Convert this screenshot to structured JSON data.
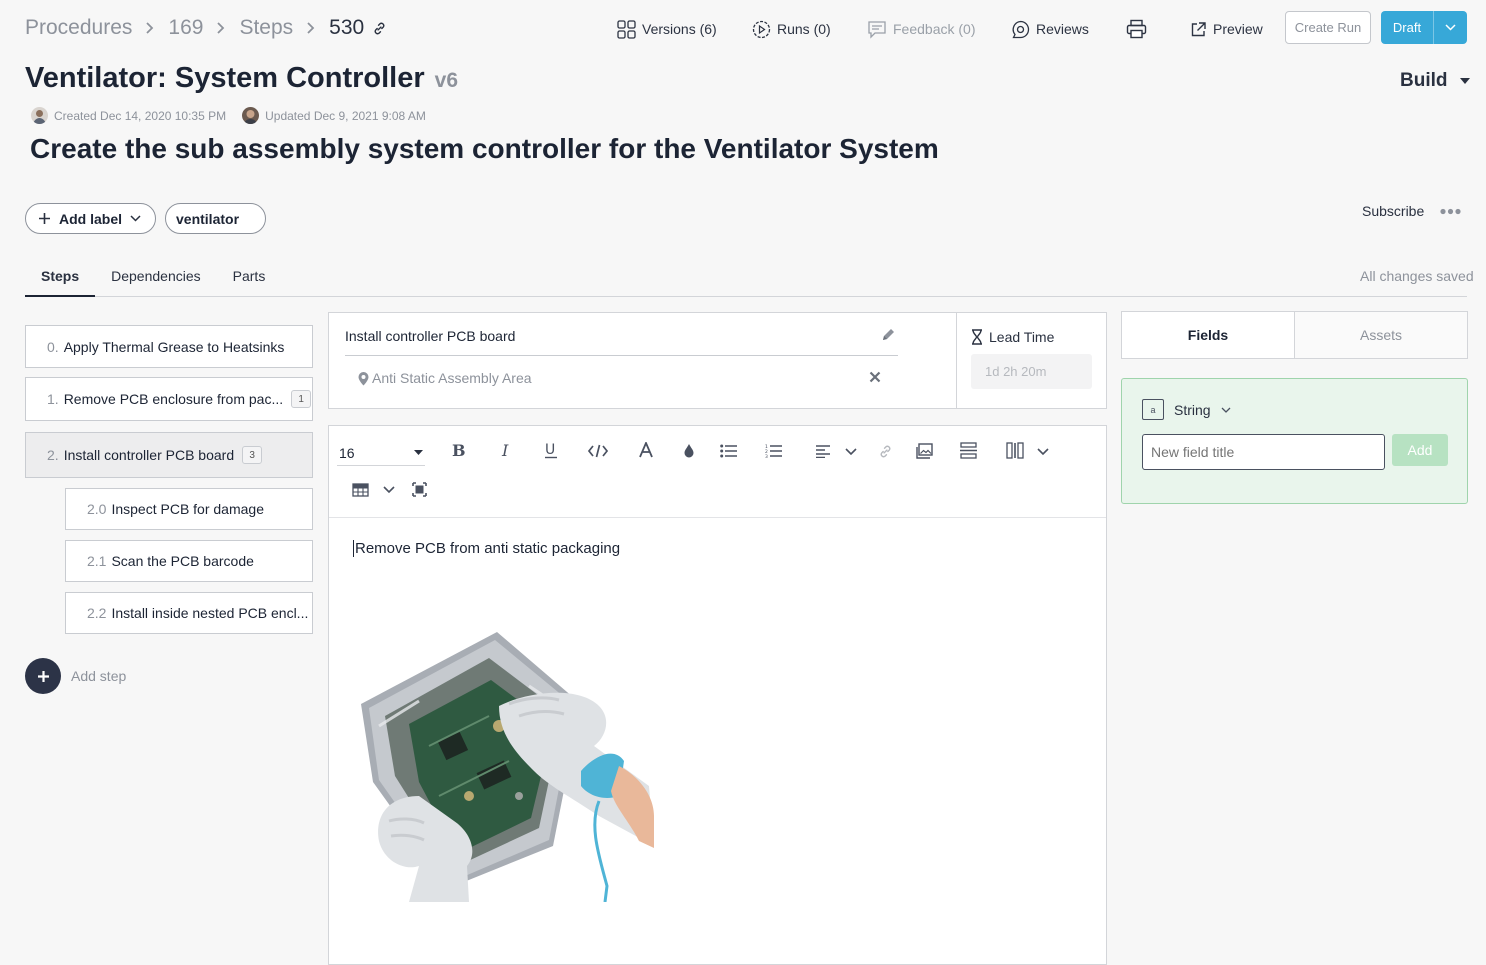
{
  "breadcrumb": {
    "root": "Procedures",
    "procedure_id": "169",
    "section": "Steps",
    "step_id": "530"
  },
  "topnav": {
    "versions": "Versions (6)",
    "runs": "Runs (0)",
    "feedback": "Feedback (0)",
    "reviews": "Reviews",
    "preview": "Preview",
    "create_run": "Create Run",
    "draft": "Draft"
  },
  "header": {
    "title": "Ventilator: System Controller",
    "version": "v6",
    "mode": "Build",
    "created": "Created Dec 14, 2020 10:35 PM",
    "updated": "Updated Dec 9, 2021 9:08 AM",
    "description": "Create the sub assembly system controller for the Ventilator System"
  },
  "labels": {
    "add_label": "Add label",
    "chips": [
      "ventilator"
    ]
  },
  "subscribe": "Subscribe",
  "tabs": [
    {
      "label": "Steps",
      "active": true
    },
    {
      "label": "Dependencies",
      "active": false
    },
    {
      "label": "Parts",
      "active": false
    }
  ],
  "save_status": "All changes saved",
  "steps": [
    {
      "num": "0.",
      "label": "Apply Thermal Grease to Heatsinks",
      "badge": null
    },
    {
      "num": "1.",
      "label": "Remove PCB enclosure from pac...",
      "badge": "1"
    },
    {
      "num": "2.",
      "label": "Install controller PCB board",
      "badge": "3"
    }
  ],
  "substeps": [
    {
      "num": "2.0",
      "label": "Inspect PCB for damage"
    },
    {
      "num": "2.1",
      "label": "Scan the PCB barcode"
    },
    {
      "num": "2.2",
      "label": "Install inside nested PCB encl..."
    }
  ],
  "add_step": "Add step",
  "step_detail": {
    "name": "Install controller PCB board",
    "location": "Anti Static Assembly Area",
    "lead_time_label": "Lead Time",
    "lead_time_placeholder": "1d 2h 20m"
  },
  "editor": {
    "font_size": "16",
    "content": "Remove PCB from anti static packaging"
  },
  "fields_panel": {
    "tab_fields": "Fields",
    "tab_assets": "Assets",
    "type_icon_text": "a",
    "type": "String",
    "placeholder": "New field title",
    "add": "Add"
  },
  "colors": {
    "accent": "#37a8d8",
    "field_panel_bg": "#e9f5ec",
    "field_panel_border": "#9fd4ac",
    "add_button": "#b7e2c2",
    "add_step_circle": "#2c3347"
  }
}
